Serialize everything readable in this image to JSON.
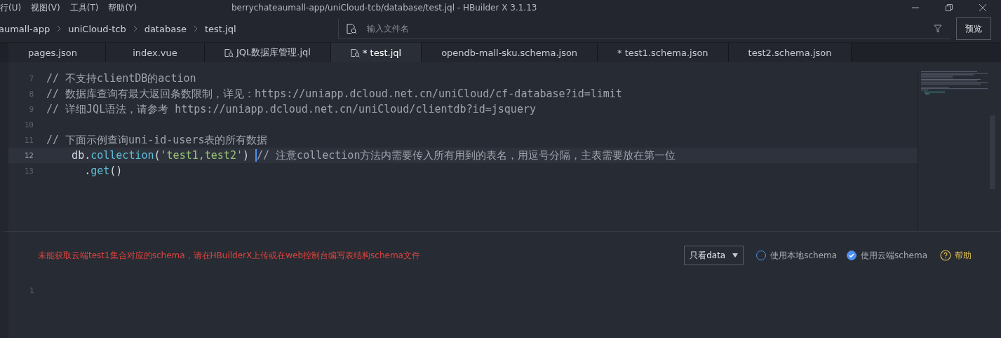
{
  "menu": [
    {
      "label": "行(U)"
    },
    {
      "label": "视图(V)"
    },
    {
      "label": "工具(T)"
    },
    {
      "label": "帮助(Y)"
    }
  ],
  "window": {
    "title": "berrychateaumall-app/uniCloud-tcb/database/test.jql - HBuilder X 3.1.13"
  },
  "breadcrumb": [
    "aumall-app",
    "uniCloud-tcb",
    "database",
    "test.jql"
  ],
  "file_search": {
    "placeholder": "输入文件名"
  },
  "preview_button": "预览",
  "tabs": [
    {
      "label": "pages.json",
      "selected": false,
      "kind": "plain"
    },
    {
      "label": "index.vue",
      "selected": false,
      "kind": "plain"
    },
    {
      "label": "JQL数据库管理.jql",
      "selected": false,
      "kind": "jql"
    },
    {
      "label": "* test.jql",
      "selected": true,
      "kind": "jql"
    },
    {
      "label": "opendb-mall-sku.schema.json",
      "selected": false,
      "kind": "plain"
    },
    {
      "label": "* test1.schema.json",
      "selected": false,
      "kind": "plain"
    },
    {
      "label": "test2.schema.json",
      "selected": false,
      "kind": "plain"
    }
  ],
  "code_lines": [
    {
      "number": "7",
      "current": false,
      "tokens": [
        {
          "kind": "comment",
          "text": "// 不支持clientDB的action"
        }
      ]
    },
    {
      "number": "8",
      "current": false,
      "tokens": [
        {
          "kind": "comment",
          "text": "// 数据库查询有最大返回条数限制，详见：https://uniapp.dcloud.net.cn/uniCloud/cf-database?id=limit"
        }
      ]
    },
    {
      "number": "9",
      "current": false,
      "tokens": [
        {
          "kind": "comment",
          "text": "// 详细JQL语法，请参考 https://uniapp.dcloud.net.cn/uniCloud/clientdb?id=jsquery"
        }
      ]
    },
    {
      "number": "10",
      "current": false
    },
    {
      "number": "11",
      "current": false,
      "tokens": [
        {
          "kind": "comment",
          "text": "// 下面示例查询uni-id-users表的所有数据"
        }
      ]
    },
    {
      "number": "12",
      "current": true,
      "tokens": [
        {
          "kind": "plain",
          "text": "    db."
        },
        {
          "kind": "method",
          "text": "collection"
        },
        {
          "kind": "plain",
          "text": "("
        },
        {
          "kind": "string",
          "text": "'test1,test2'"
        },
        {
          "kind": "plain",
          "text": ") "
        },
        {
          "kind": "cursor"
        },
        {
          "kind": "comment",
          "text": "// 注意collection方法内需要传入所有用到的表名，用逗号分隔，主表需要放在第一位"
        }
      ]
    },
    {
      "number": "13",
      "current": false,
      "tokens": [
        {
          "kind": "plain",
          "text": "      ."
        },
        {
          "kind": "method",
          "text": "get"
        },
        {
          "kind": "plain",
          "text": "()"
        }
      ]
    }
  ],
  "result_panel": {
    "error": "未能获取云端test1集合对应的schema，请在HBuilderX上传或在web控制台编写表结构schema文件",
    "view_select": "只看data",
    "schema_options": [
      {
        "label": "使用本地schema",
        "selected": false
      },
      {
        "label": "使用云端schema",
        "selected": true
      }
    ],
    "help": "帮助",
    "line_number": "1"
  }
}
